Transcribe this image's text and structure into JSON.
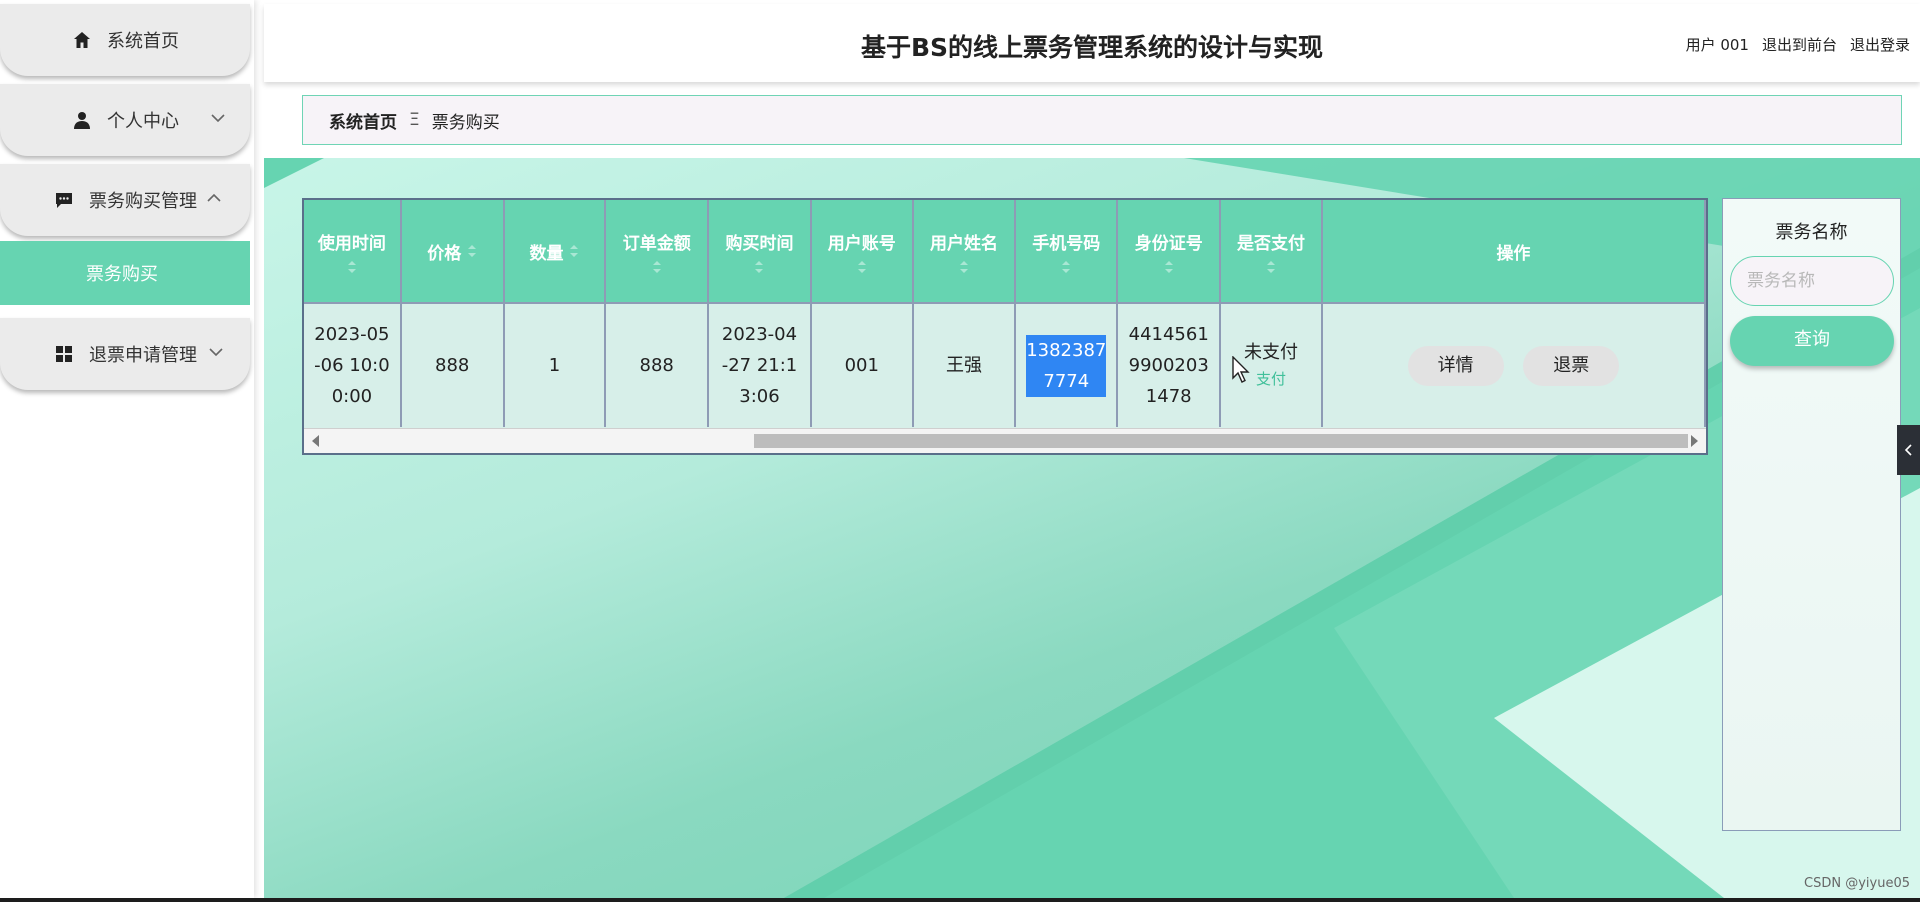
{
  "sidebar": {
    "items": [
      {
        "label": "系统首页",
        "icon": "home-icon"
      },
      {
        "label": "个人中心",
        "icon": "user-icon"
      },
      {
        "label": "票务购买管理",
        "icon": "chat-icon"
      },
      {
        "label": "退票申请管理",
        "icon": "grid-icon"
      }
    ],
    "sub_item": "票务购买"
  },
  "header": {
    "title": "基于BS的线上票务管理系统的设计与实现",
    "user": "用户 001",
    "exit_front": "退出到前台",
    "logout": "退出登录"
  },
  "breadcrumb": {
    "home": "系统首页",
    "separator": "Ξ",
    "current": "票务购买"
  },
  "table": {
    "columns": [
      "使用时间",
      "价格",
      "数量",
      "订单金额",
      "购买时间",
      "用户账号",
      "用户姓名",
      "手机号码",
      "身份证号",
      "是否支付",
      "操作"
    ],
    "rows": [
      {
        "use_time_1": "2023-05",
        "use_time_2": "-06 10:0",
        "use_time_3": "0:00",
        "price": "888",
        "quantity": "1",
        "amount": "888",
        "buy_time_1": "2023-04",
        "buy_time_2": "-27 21:1",
        "buy_time_3": "3:06",
        "account": "001",
        "name": "王强",
        "phone_1": "1382387",
        "phone_2": "7774",
        "id_1": "4414561",
        "id_2": "9900203",
        "id_3": "1478",
        "paid": "未支付",
        "pay_link": "支付",
        "detail": "详情",
        "refund": "退票"
      }
    ]
  },
  "search": {
    "label": "票务名称",
    "placeholder": "票务名称",
    "button": "查询"
  },
  "watermark": "CSDN @yiyue05",
  "colors": {
    "accent": "#66d4b1",
    "selection": "#2f86f3",
    "border": "#8e9bb5"
  }
}
